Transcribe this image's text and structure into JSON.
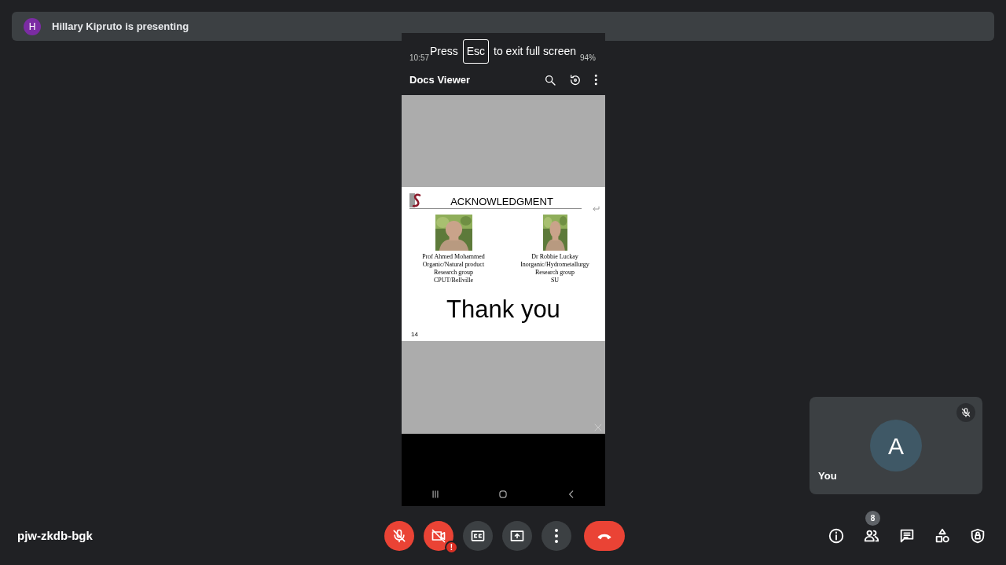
{
  "presenter_bar": {
    "avatar_letter": "H",
    "text": "Hillary Kipruto is presenting"
  },
  "fullscreen_hint": {
    "before": "Press",
    "key": "Esc",
    "after": "to exit full screen"
  },
  "phone": {
    "status_time": "10:57",
    "battery": "94%",
    "app_title": "Docs Viewer",
    "slide": {
      "title": "ACKNOWLEDGMENT",
      "people": [
        {
          "lines": [
            "Prof Ahmed Mohammed",
            "Organic/Natural product",
            "Research group",
            "CPUT/Bellville"
          ]
        },
        {
          "lines": [
            "Dr Robbie Luckay",
            "Inorganic/Hydrometallurgy",
            "Research group",
            "SU"
          ]
        }
      ],
      "closing": "Thank you",
      "page_number": "14"
    }
  },
  "self_tile": {
    "initial": "A",
    "label": "You",
    "muted": true
  },
  "meeting_code": "pjw-zkdb-bgk",
  "controls": [
    {
      "kind": "mic",
      "off": true
    },
    {
      "kind": "camera",
      "off": true,
      "warning": "!"
    },
    {
      "kind": "captions",
      "off": false
    },
    {
      "kind": "present",
      "off": false
    },
    {
      "kind": "more",
      "off": false
    },
    {
      "kind": "leave"
    }
  ],
  "side_controls": [
    {
      "kind": "info"
    },
    {
      "kind": "people",
      "badge": "8"
    },
    {
      "kind": "chat"
    },
    {
      "kind": "activities"
    },
    {
      "kind": "host"
    }
  ]
}
